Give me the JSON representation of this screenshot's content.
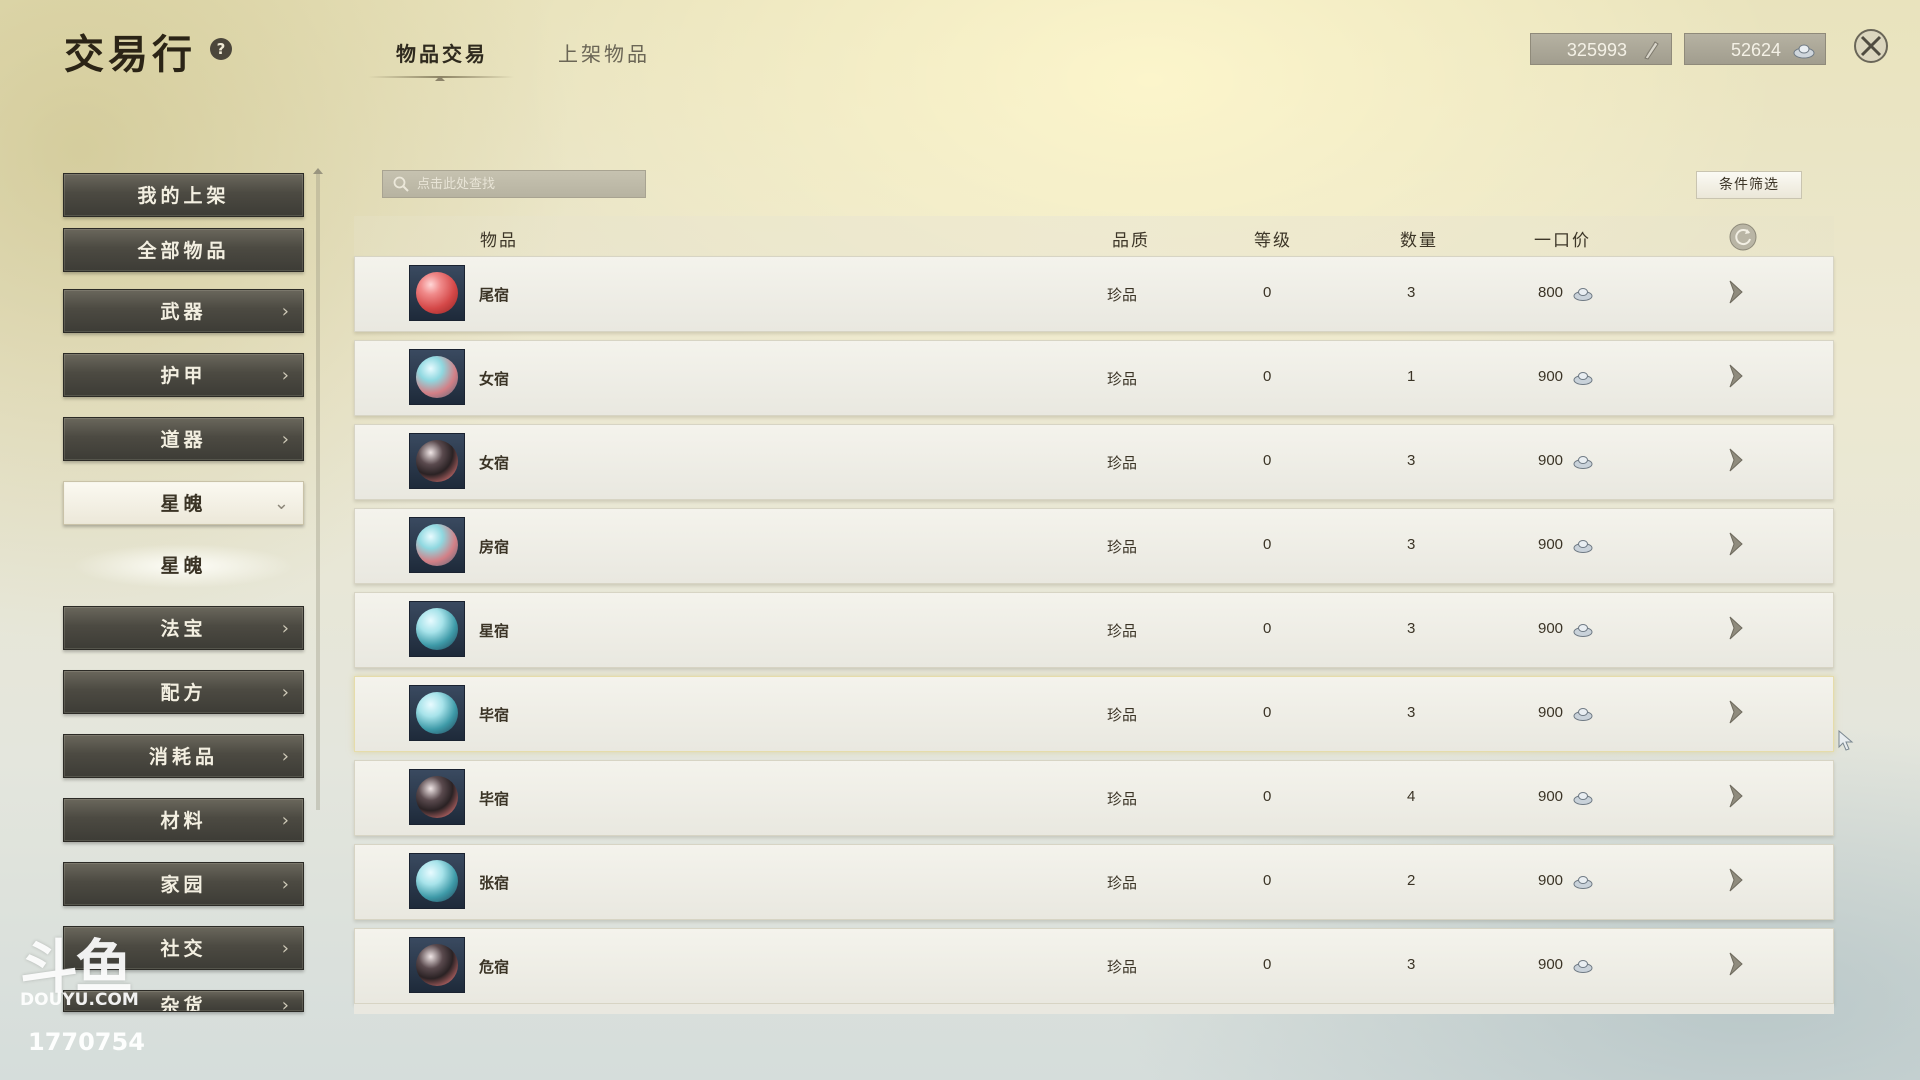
{
  "header": {
    "title": "交易行",
    "help_symbol": "?",
    "tabs": [
      {
        "label": "物品交易",
        "active": true
      },
      {
        "label": "上架物品",
        "active": false
      }
    ],
    "currency": [
      {
        "value": "325993",
        "icon": "scroll-token-icon"
      },
      {
        "value": "52624",
        "icon": "silver-ingot-icon"
      }
    ],
    "close_icon": "close-icon"
  },
  "sidebar": {
    "items": [
      {
        "label": "我的上架",
        "has_arrow": false
      },
      {
        "label": "全部物品",
        "has_arrow": false
      },
      {
        "label": "武器",
        "has_arrow": true
      },
      {
        "label": "护甲",
        "has_arrow": true
      },
      {
        "label": "道器",
        "has_arrow": true
      },
      {
        "label": "星魄",
        "expanded": true
      },
      {
        "label": "法宝",
        "has_arrow": true
      },
      {
        "label": "配方",
        "has_arrow": true
      },
      {
        "label": "消耗品",
        "has_arrow": true
      },
      {
        "label": "材料",
        "has_arrow": true
      },
      {
        "label": "家园",
        "has_arrow": true
      },
      {
        "label": "社交",
        "has_arrow": true
      },
      {
        "label": "杂货",
        "has_arrow": true
      }
    ],
    "sub_item": "星魄",
    "arrow_glyph": "›",
    "expand_glyph": "⌄"
  },
  "search": {
    "placeholder": "点击此处查找",
    "value": ""
  },
  "filter_button": "条件筛选",
  "table": {
    "headers": {
      "item": "物品",
      "quality": "品质",
      "level": "等级",
      "quantity": "数量",
      "price": "一口价"
    },
    "rows": [
      {
        "name": "尾宿",
        "quality": "珍品",
        "level": "0",
        "quantity": "3",
        "price": "800",
        "orb": "red"
      },
      {
        "name": "女宿",
        "quality": "珍品",
        "level": "0",
        "quantity": "1",
        "price": "900",
        "orb": "cyan"
      },
      {
        "name": "女宿",
        "quality": "珍品",
        "level": "0",
        "quantity": "3",
        "price": "900",
        "orb": "dark"
      },
      {
        "name": "房宿",
        "quality": "珍品",
        "level": "0",
        "quantity": "3",
        "price": "900",
        "orb": "cyan"
      },
      {
        "name": "星宿",
        "quality": "珍品",
        "level": "0",
        "quantity": "3",
        "price": "900",
        "orb": "cyan2"
      },
      {
        "name": "毕宿",
        "quality": "珍品",
        "level": "0",
        "quantity": "3",
        "price": "900",
        "orb": "cyan2"
      },
      {
        "name": "毕宿",
        "quality": "珍品",
        "level": "0",
        "quantity": "4",
        "price": "900",
        "orb": "dark"
      },
      {
        "name": "张宿",
        "quality": "珍品",
        "level": "0",
        "quantity": "2",
        "price": "900",
        "orb": "cyan2"
      },
      {
        "name": "危宿",
        "quality": "珍品",
        "level": "0",
        "quantity": "3",
        "price": "900",
        "orb": "dark"
      }
    ]
  },
  "watermark": {
    "logo": "斗鱼",
    "site": "DOUYU.COM",
    "room_id": "1770754"
  }
}
